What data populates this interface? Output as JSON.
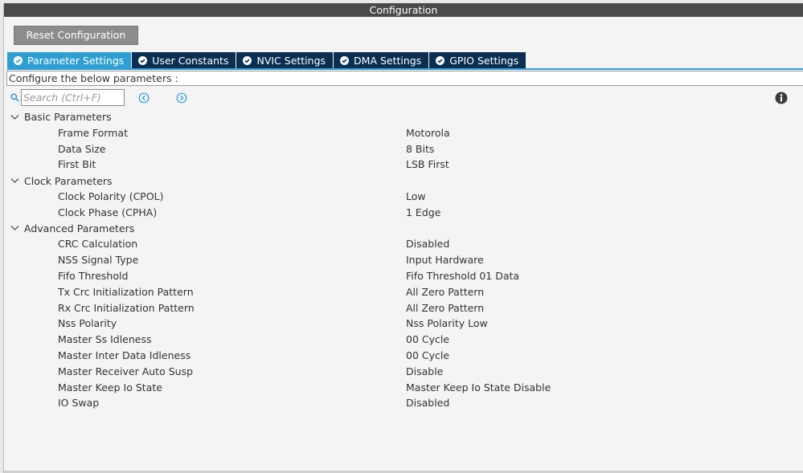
{
  "window": {
    "title": "Configuration"
  },
  "toolbar": {
    "reset_label": "Reset Configuration"
  },
  "tabs": [
    {
      "label": "Parameter Settings",
      "active": true
    },
    {
      "label": "User Constants",
      "active": false
    },
    {
      "label": "NVIC Settings",
      "active": false
    },
    {
      "label": "DMA Settings",
      "active": false
    },
    {
      "label": "GPIO Settings",
      "active": false
    }
  ],
  "description": "Configure the below parameters :",
  "search": {
    "placeholder": "Search (Ctrl+F)"
  },
  "icons": {
    "search": "search-icon",
    "prev": "arrow-left-circle-icon",
    "next": "arrow-right-circle-icon",
    "info": "info-icon",
    "check": "check-circle-icon",
    "chevron": "chevron-down-icon"
  },
  "colors": {
    "title_bar": "#4a4a4c",
    "tab_active": "#2f9fd3",
    "tab_inactive": "#0a2f52",
    "button": "#8c8c8c",
    "accent": "#2f9fd3"
  },
  "groups": [
    {
      "label": "Basic Parameters",
      "params": [
        {
          "name": "Frame Format",
          "value": "Motorola"
        },
        {
          "name": "Data Size",
          "value": "8 Bits"
        },
        {
          "name": "First Bit",
          "value": "LSB First"
        }
      ]
    },
    {
      "label": "Clock Parameters",
      "params": [
        {
          "name": "Clock Polarity (CPOL)",
          "value": "Low"
        },
        {
          "name": "Clock Phase (CPHA)",
          "value": "1 Edge"
        }
      ]
    },
    {
      "label": "Advanced Parameters",
      "params": [
        {
          "name": "CRC Calculation",
          "value": "Disabled"
        },
        {
          "name": "NSS Signal Type",
          "value": "Input Hardware"
        },
        {
          "name": "Fifo Threshold",
          "value": "Fifo Threshold 01 Data"
        },
        {
          "name": "Tx Crc Initialization Pattern",
          "value": "All Zero Pattern"
        },
        {
          "name": "Rx Crc Initialization Pattern",
          "value": "All Zero Pattern"
        },
        {
          "name": "Nss Polarity",
          "value": "Nss Polarity Low"
        },
        {
          "name": "Master Ss Idleness",
          "value": "00 Cycle"
        },
        {
          "name": "Master Inter Data Idleness",
          "value": "00 Cycle"
        },
        {
          "name": "Master Receiver Auto Susp",
          "value": "Disable"
        },
        {
          "name": "Master Keep Io State",
          "value": "Master Keep Io State Disable"
        },
        {
          "name": "IO Swap",
          "value": "Disabled"
        }
      ]
    }
  ]
}
